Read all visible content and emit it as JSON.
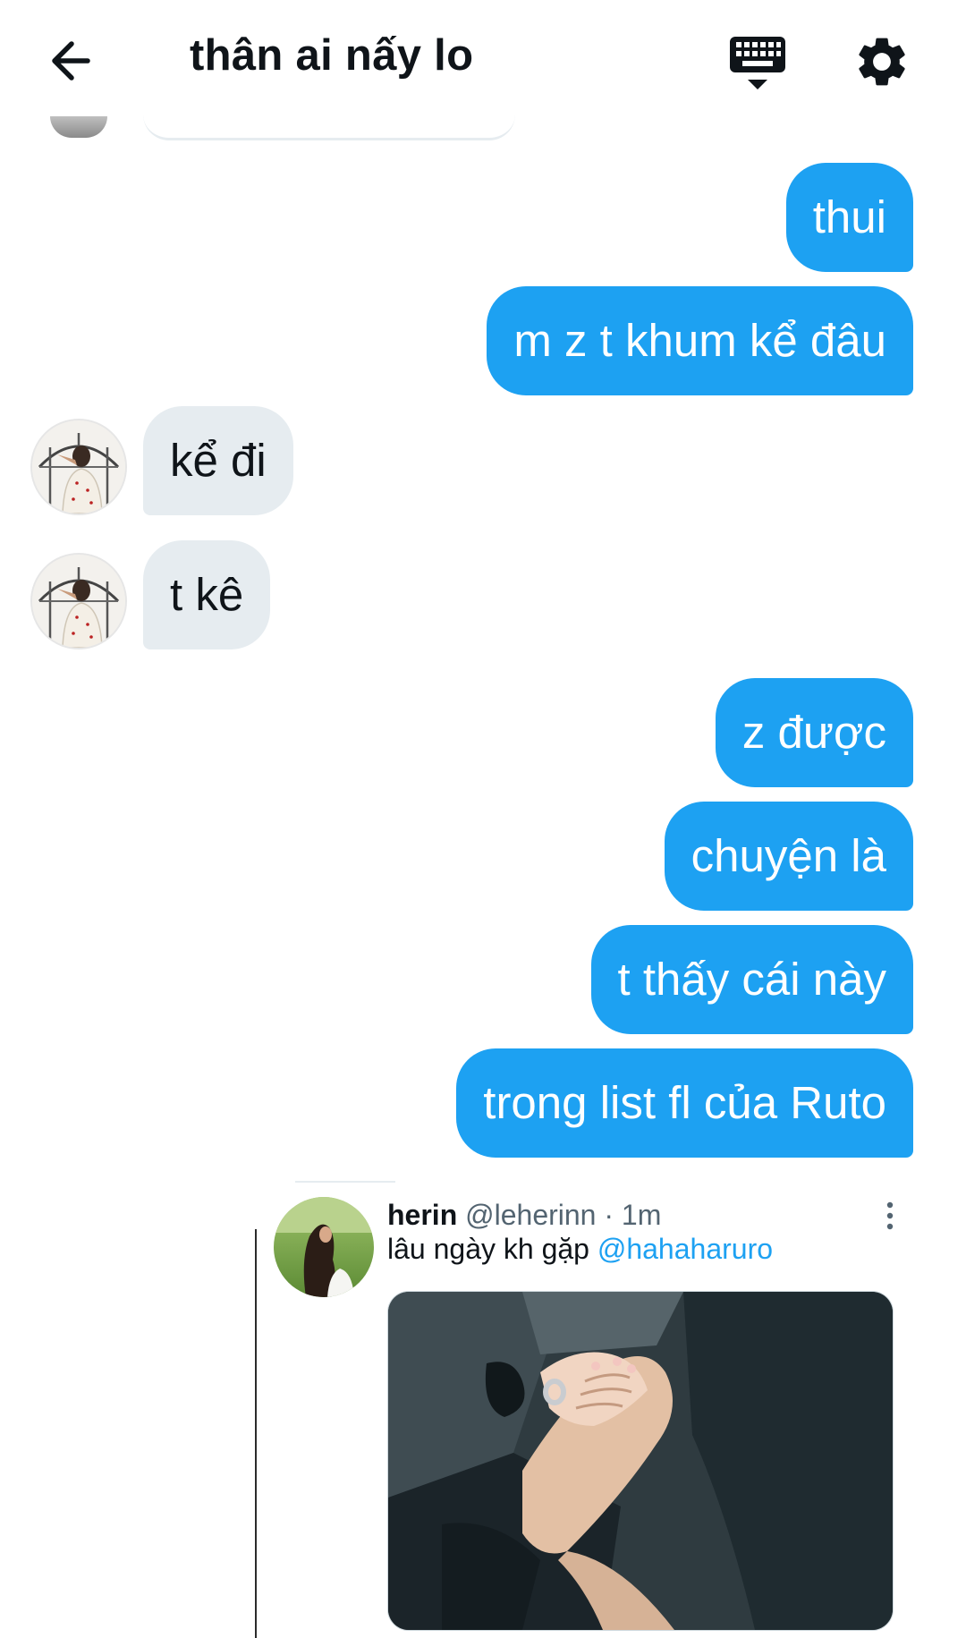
{
  "header": {
    "title": "thân ai nấy lo",
    "icons": {
      "back": "arrow-left-icon",
      "keyboard": "keyboard-icon",
      "settings": "gear-icon"
    }
  },
  "messages": [
    {
      "dir": "out",
      "text": "thui"
    },
    {
      "dir": "out",
      "text": "m z t khum kể đâu"
    },
    {
      "dir": "in",
      "text": "kể đi"
    },
    {
      "dir": "in",
      "text": "t kê"
    },
    {
      "dir": "out",
      "text": "z được"
    },
    {
      "dir": "out",
      "text": "chuyện là"
    },
    {
      "dir": "out",
      "text": "t thấy cái này"
    },
    {
      "dir": "out",
      "text": "trong list fl của Ruto"
    }
  ],
  "shared_tweet": {
    "name": "herin",
    "handle": "@leherinn",
    "separator": "·",
    "time": "1m",
    "text": "lâu ngày kh gặp",
    "mention": "@hahaharuro",
    "icons": {
      "more": "more-vertical-icon",
      "media": "photo-hands-icon",
      "avatar": "profile-photo-icon"
    }
  },
  "colors": {
    "outgoing_bubble": "#1da1f2",
    "incoming_bubble": "#e6ecf0",
    "mention": "#1da1f2"
  }
}
